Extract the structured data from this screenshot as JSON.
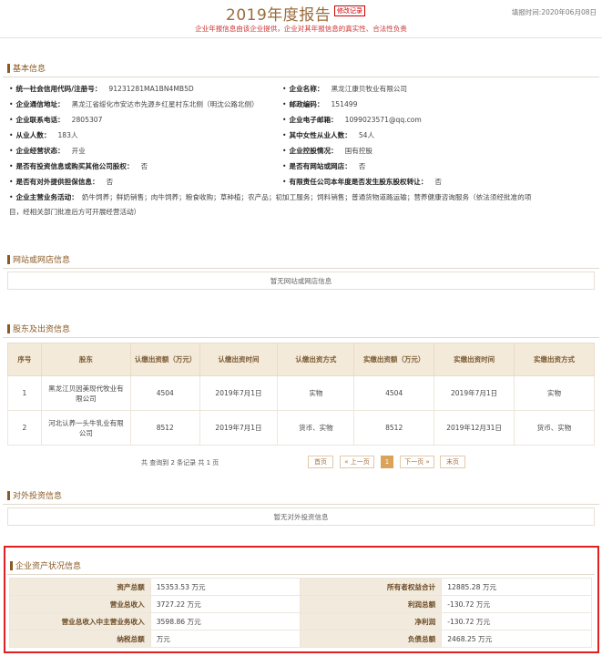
{
  "header": {
    "title": "2019年度报告",
    "edit_badge": "修改记录",
    "fill_date": "填报时间:2020年06月08日",
    "subtitle": "企业年报信息由该企业提供，企业对其年报信息的真实性、合法性负责"
  },
  "basic": {
    "section_title": "基本信息",
    "credit_code_label": "统一社会信用代码/注册号：",
    "credit_code": "91231281MA1BN4MB5D",
    "name_label": "企业名称：",
    "name": "黑龙江康贝牧业有限公司",
    "address_label": "企业通信地址：",
    "address": "黑龙江省绥化市安达市先源乡红星村东北侧（明沈公路北侧）",
    "postcode_label": "邮政编码：",
    "postcode": "151499",
    "phone_label": "企业联系电话：",
    "phone": "2805307",
    "email_label": "企业电子邮箱：",
    "email": "1099023571@qq.com",
    "employees_label": "从业人数：",
    "employees": "183人",
    "female_label": "其中女性从业人数：",
    "female": "54人",
    "status_label": "企业经营状态：",
    "status": "开业",
    "holding_label": "企业控股情况：",
    "holding": "国有控股",
    "invest_label": "是否有投资信息或购买其他公司股权：",
    "invest": "否",
    "website_label": "是否有网站或网店：",
    "website": "否",
    "guarantee_label": "是否有对外提供担保信息：",
    "guarantee": "否",
    "transfer_label": "有限责任公司本年度是否发生股东股权转让：",
    "transfer": "否",
    "scope_label": "企业主营业务活动：",
    "scope_line1": "奶牛饲养；鲜奶销售；肉牛饲养；粮食收购；草种植；农产品；初加工服务；饲料销售；普通货物道路运输；营养健康咨询服务（依法须经批准的项",
    "scope_line2": "目，经相关部门批准后方可开展经营活动）"
  },
  "website_section": {
    "section_title": "网站或网店信息",
    "empty": "暂无网站或网店信息"
  },
  "shareholders": {
    "section_title": "股东及出资信息",
    "headers": [
      "序号",
      "股东",
      "认缴出资额（万元）",
      "认缴出资时间",
      "认缴出资方式",
      "实缴出资额（万元）",
      "实缴出资时间",
      "实缴出资方式"
    ],
    "rows": [
      [
        "1",
        "黑龙江贝因美现代牧业有限公司",
        "4504",
        "2019年7月1日",
        "实物",
        "4504",
        "2019年7月1日",
        "实物"
      ],
      [
        "2",
        "河北认养一头牛乳业有限公司",
        "8512",
        "2019年7月1日",
        "货币、实物",
        "8512",
        "2019年12月31日",
        "货币、实物"
      ]
    ],
    "pager_info": "共 查询到 2 条记录 共 1 页",
    "first": "首页",
    "prev": "« 上一页",
    "page": "1",
    "next": "下一页 »",
    "last": "末页"
  },
  "investment": {
    "section_title": "对外投资信息",
    "empty": "暂无对外投资信息"
  },
  "assets": {
    "section_title": "企业资产状况信息",
    "rows": [
      [
        "资产总额",
        "15353.53 万元",
        "所有者权益合计",
        "12885.28 万元"
      ],
      [
        "营业总收入",
        "3727.22 万元",
        "利润总额",
        "-130.72 万元"
      ],
      [
        "营业总收入中主营业务收入",
        "3598.86 万元",
        "净利润",
        "-130.72 万元"
      ],
      [
        "纳税总额",
        "万元",
        "负债总额",
        "2468.25 万元"
      ]
    ]
  }
}
